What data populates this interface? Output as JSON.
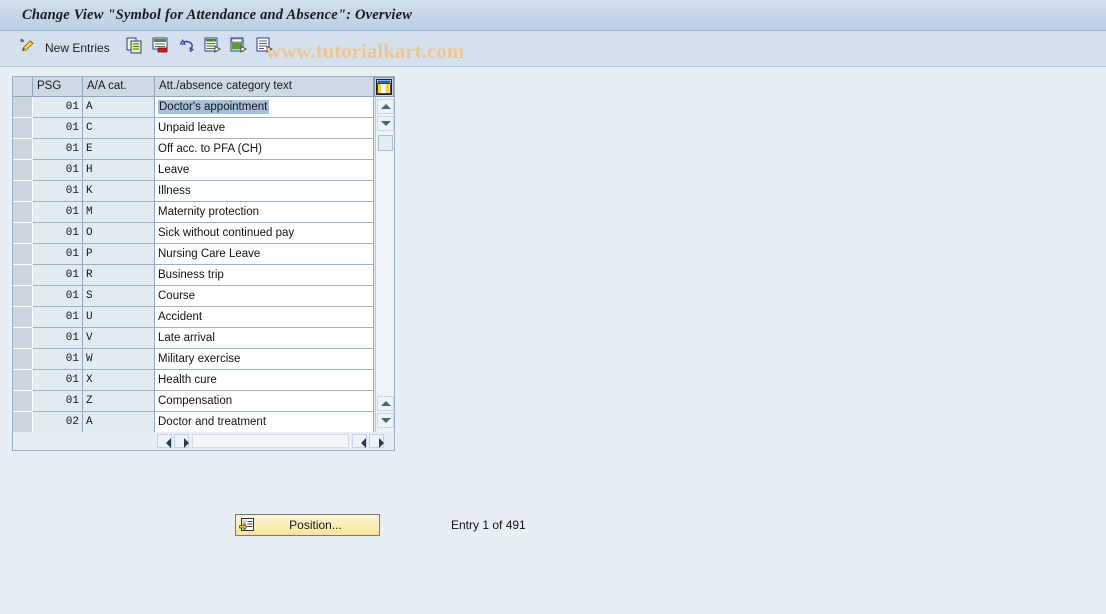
{
  "window": {
    "title": "Change View \"Symbol for Attendance and Absence\": Overview"
  },
  "watermark": {
    "text": "www.tutorialkart.com",
    "color": "#eec592"
  },
  "toolbar": {
    "pencil_icon": "pencil-edit-icon",
    "new_entries_label": "New Entries",
    "icons": [
      {
        "name": "copy-as-icon"
      },
      {
        "name": "delete-icon"
      },
      {
        "name": "undo-icon"
      },
      {
        "name": "select-all-icon"
      },
      {
        "name": "deselect-all-icon"
      },
      {
        "name": "details-icon"
      }
    ]
  },
  "grid": {
    "settings_icon": "table-settings-icon",
    "columns": [
      {
        "key": "sel",
        "label": ""
      },
      {
        "key": "psg",
        "label": "PSG"
      },
      {
        "key": "aa",
        "label": "A/A cat."
      },
      {
        "key": "text",
        "label": "Att./absence category text"
      }
    ],
    "rows": [
      {
        "psg": "01",
        "aa": "A",
        "text": "Doctor's appointment",
        "selected": true
      },
      {
        "psg": "01",
        "aa": "C",
        "text": "Unpaid leave",
        "selected": false
      },
      {
        "psg": "01",
        "aa": "E",
        "text": "Off acc. to PFA (CH)",
        "selected": false
      },
      {
        "psg": "01",
        "aa": "H",
        "text": "Leave",
        "selected": false
      },
      {
        "psg": "01",
        "aa": "K",
        "text": "Illness",
        "selected": false
      },
      {
        "psg": "01",
        "aa": "M",
        "text": "Maternity protection",
        "selected": false
      },
      {
        "psg": "01",
        "aa": "O",
        "text": "Sick without continued pay",
        "selected": false
      },
      {
        "psg": "01",
        "aa": "P",
        "text": "Nursing Care Leave",
        "selected": false
      },
      {
        "psg": "01",
        "aa": "R",
        "text": "Business trip",
        "selected": false
      },
      {
        "psg": "01",
        "aa": "S",
        "text": "Course",
        "selected": false
      },
      {
        "psg": "01",
        "aa": "U",
        "text": "Accident",
        "selected": false
      },
      {
        "psg": "01",
        "aa": "V",
        "text": "Late arrival",
        "selected": false
      },
      {
        "psg": "01",
        "aa": "W",
        "text": "Military exercise",
        "selected": false
      },
      {
        "psg": "01",
        "aa": "X",
        "text": "Health cure",
        "selected": false
      },
      {
        "psg": "01",
        "aa": "Z",
        "text": "Compensation",
        "selected": false
      },
      {
        "psg": "02",
        "aa": "A",
        "text": "Doctor and treatment",
        "selected": false
      }
    ]
  },
  "footer": {
    "position_button_label": "Position...",
    "position_icon": "position-goto-icon",
    "entry_status": "Entry 1 of 491"
  },
  "colors": {
    "background": "#e8eef5",
    "titlebar": "#c5d6e8",
    "toolbar": "#d4e0ed",
    "header_cell": "#ced9e5",
    "row_key_cell": "#e2eaf2",
    "row_text_cell": "#ffffff",
    "selection": "#a8c0d8",
    "button_yellow": "#fbeeb8"
  }
}
